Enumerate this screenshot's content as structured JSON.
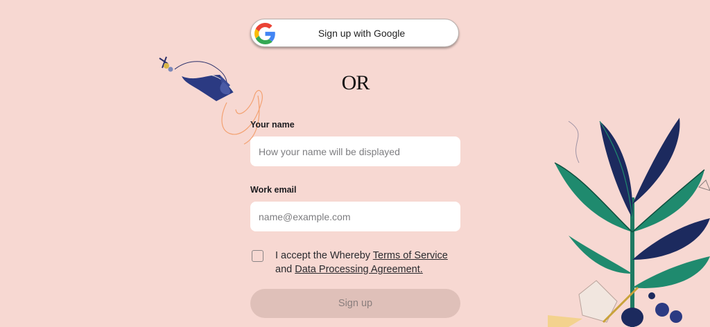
{
  "google": {
    "label": "Sign up with Google",
    "icon": "google-g-icon"
  },
  "divider": {
    "text": "OR"
  },
  "name_field": {
    "label": "Your name",
    "placeholder": "How your name will be displayed",
    "value": ""
  },
  "email_field": {
    "label": "Work email",
    "placeholder": "name@example.com",
    "value": ""
  },
  "terms": {
    "prefix": "I accept the Whereby ",
    "tos_link": "Terms of Service",
    "middle": "and ",
    "dpa_link": "Data Processing Agreement."
  },
  "signup": {
    "label": "Sign up"
  },
  "colors": {
    "background": "#f7d8d2",
    "button_disabled": "#dfc0b9",
    "leaf_green": "#1f8a6e",
    "leaf_navy": "#1c2a5e"
  }
}
